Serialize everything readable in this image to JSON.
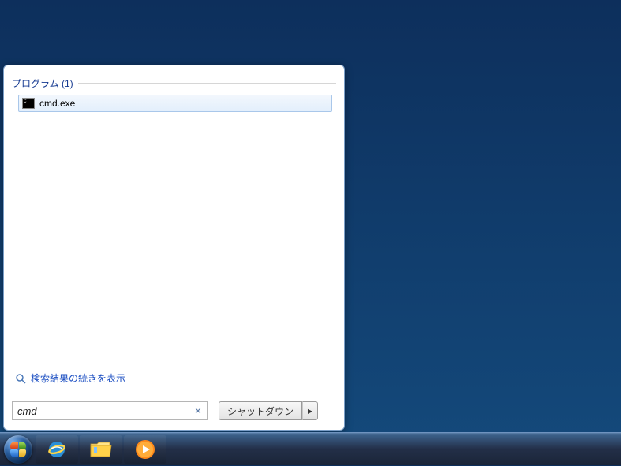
{
  "start_menu": {
    "programs_header": "プログラム (1)",
    "results": [
      {
        "label": "cmd.exe",
        "icon": "cmd-icon"
      }
    ],
    "more_results_label": "検索結果の続きを表示",
    "search_value": "cmd",
    "shutdown_label": "シャットダウン"
  },
  "taskbar": {
    "items": [
      {
        "name": "start",
        "icon": "windows-orb"
      },
      {
        "name": "internet-explorer",
        "icon": "ie-icon"
      },
      {
        "name": "file-explorer",
        "icon": "folder-icon"
      },
      {
        "name": "windows-media-player",
        "icon": "wmp-icon"
      }
    ]
  }
}
